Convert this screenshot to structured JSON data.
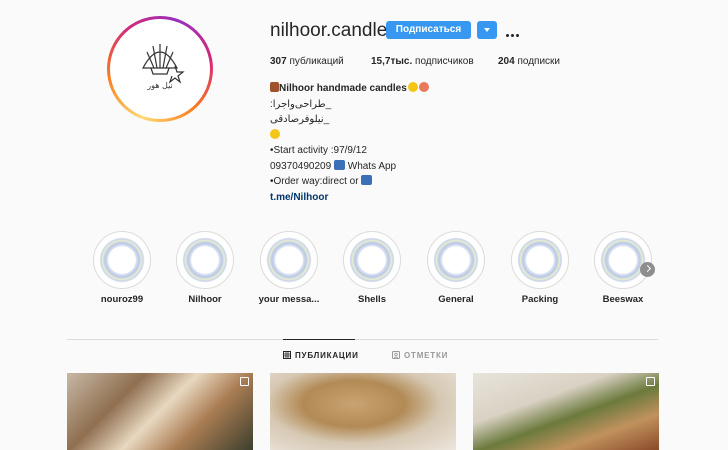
{
  "profile": {
    "username": "nilhoor.candle",
    "subscribe_label": "Подписаться",
    "avatar_text": "نیل هور"
  },
  "stats": {
    "posts_count": "307",
    "posts_label": "публикаций",
    "followers_count": "15,7тыс.",
    "followers_label": "подписчиков",
    "following_count": "204",
    "following_label": "подписки"
  },
  "bio": {
    "name": "Nilhoor handmade candles",
    "line2": "_طراحی‌واجرا:",
    "line3": "_نیلوفرصادقی",
    "line5": "•Start activity :97/9/12",
    "line6_phone": "09370490209",
    "line6_suffix": "Whats App",
    "line7": "•Order way:direct or",
    "link": "t.me/Nilhoor"
  },
  "highlights": [
    {
      "label": "nouroz99"
    },
    {
      "label": "Nilhoor"
    },
    {
      "label": "your messa..."
    },
    {
      "label": "Shells"
    },
    {
      "label": "General"
    },
    {
      "label": "Packing"
    },
    {
      "label": "Beeswax"
    }
  ],
  "tabs": {
    "posts": "ПУБЛИКАЦИИ",
    "tagged": "ОТМЕТКИ"
  },
  "icons": {
    "more": "more-dots-icon",
    "dropdown": "chevron-down-icon",
    "next": "chevron-right-icon",
    "grid": "grid-icon",
    "tagged": "tag-icon"
  },
  "colors": {
    "accent": "#3897f0",
    "link": "#003569",
    "text": "#262626",
    "muted": "#999999"
  }
}
